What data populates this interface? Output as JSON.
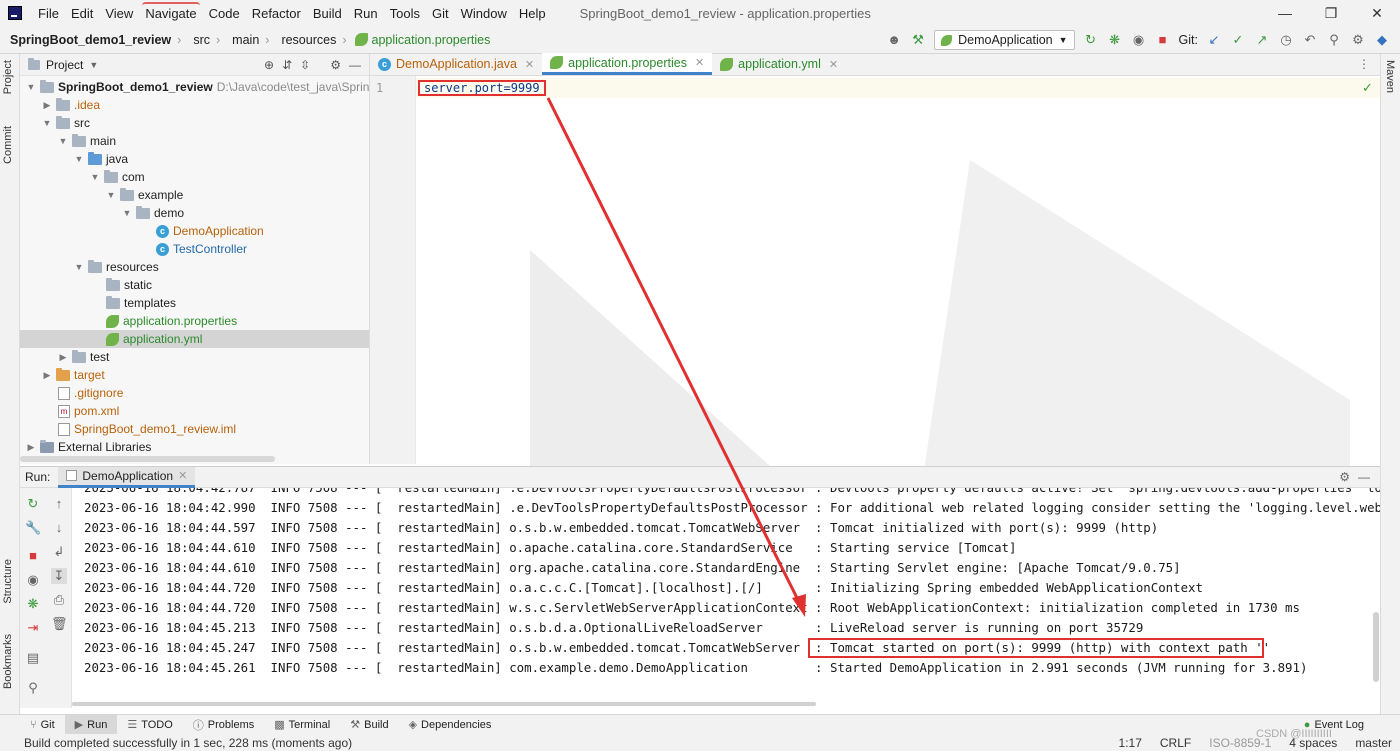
{
  "menu": {
    "items": [
      "File",
      "Edit",
      "View",
      "Navigate",
      "Code",
      "Refactor",
      "Build",
      "Run",
      "Tools",
      "Git",
      "Window",
      "Help"
    ],
    "window_title": "SpringBoot_demo1_review - application.properties"
  },
  "navbar": {
    "crumbs": [
      "SpringBoot_demo1_review",
      "src",
      "main",
      "resources"
    ],
    "file": "application.properties",
    "run_config": "DemoApplication",
    "git_label": "Git:"
  },
  "left_strip": {
    "project": "Project",
    "commit": "Commit",
    "structure": "Structure",
    "bookmarks": "Bookmarks"
  },
  "right_strip": {
    "maven": "Maven"
  },
  "project_panel": {
    "title": "Project",
    "root_name": "SpringBoot_demo1_review",
    "root_path": "D:\\Java\\code\\test_java\\SpringBo",
    "tree": [
      {
        "label": ".idea"
      },
      {
        "label": "src"
      },
      {
        "label": "main"
      },
      {
        "label": "java"
      },
      {
        "label": "com"
      },
      {
        "label": "example"
      },
      {
        "label": "demo"
      },
      {
        "label": "DemoApplication"
      },
      {
        "label": "TestController"
      },
      {
        "label": "resources"
      },
      {
        "label": "static"
      },
      {
        "label": "templates"
      },
      {
        "label": "application.properties"
      },
      {
        "label": "application.yml"
      },
      {
        "label": "test"
      },
      {
        "label": "target"
      },
      {
        "label": ".gitignore"
      },
      {
        "label": "pom.xml"
      },
      {
        "label": "SpringBoot_demo1_review.iml"
      },
      {
        "label": "External Libraries"
      }
    ]
  },
  "editor": {
    "tabs": [
      "DemoApplication.java",
      "application.properties",
      "application.yml"
    ],
    "line_number": "1",
    "code": "server.port=9999"
  },
  "run_panel": {
    "label": "Run:",
    "tab": "DemoApplication",
    "lines": [
      "2023-06-16 18:04:42.787  INFO 7508 --- [  restartedMain] .e.DevToolsPropertyDefaultsPostProcessor : Devtools property defaults active! Set 'spring.devtools.add-properties' to 'fa",
      "2023-06-16 18:04:42.990  INFO 7508 --- [  restartedMain] .e.DevToolsPropertyDefaultsPostProcessor : For additional web related logging consider setting the 'logging.level.web' pr",
      "2023-06-16 18:04:44.597  INFO 7508 --- [  restartedMain] o.s.b.w.embedded.tomcat.TomcatWebServer  : Tomcat initialized with port(s): 9999 (http)",
      "2023-06-16 18:04:44.610  INFO 7508 --- [  restartedMain] o.apache.catalina.core.StandardService   : Starting service [Tomcat]",
      "2023-06-16 18:04:44.610  INFO 7508 --- [  restartedMain] org.apache.catalina.core.StandardEngine  : Starting Servlet engine: [Apache Tomcat/9.0.75]",
      "2023-06-16 18:04:44.720  INFO 7508 --- [  restartedMain] o.a.c.c.C.[Tomcat].[localhost].[/]       : Initializing Spring embedded WebApplicationContext",
      "2023-06-16 18:04:44.720  INFO 7508 --- [  restartedMain] w.s.c.ServletWebServerApplicationContext : Root WebApplicationContext: initialization completed in 1730 ms",
      "2023-06-16 18:04:45.213  INFO 7508 --- [  restartedMain] o.s.b.d.a.OptionalLiveReloadServer       : LiveReload server is running on port 35729",
      "2023-06-16 18:04:45.247  INFO 7508 --- [  restartedMain] o.s.b.w.embedded.tomcat.TomcatWebServer  : Tomcat started on port(s): 9999 (http) with context path ''",
      "2023-06-16 18:04:45.261  INFO 7508 --- [  restartedMain] com.example.demo.DemoApplication         : Started DemoApplication in 2.991 seconds (JVM running for 3.891)"
    ]
  },
  "bottom_tools": [
    "Git",
    "Run",
    "TODO",
    "Problems",
    "Terminal",
    "Build",
    "Dependencies",
    "Event Log"
  ],
  "status": {
    "message": "Build completed successfully in 1 sec, 228 ms (moments ago)",
    "position": "1:17",
    "line_sep": "CRLF",
    "encoding": "ISO-8859-1",
    "indent": "4 spaces",
    "branch": "master",
    "watermark": "CSDN @IIIIIIIIII"
  },
  "colors": {
    "accent": "#4083c9",
    "annotation_red": "#e03030",
    "spring_green": "#6fb34a"
  }
}
